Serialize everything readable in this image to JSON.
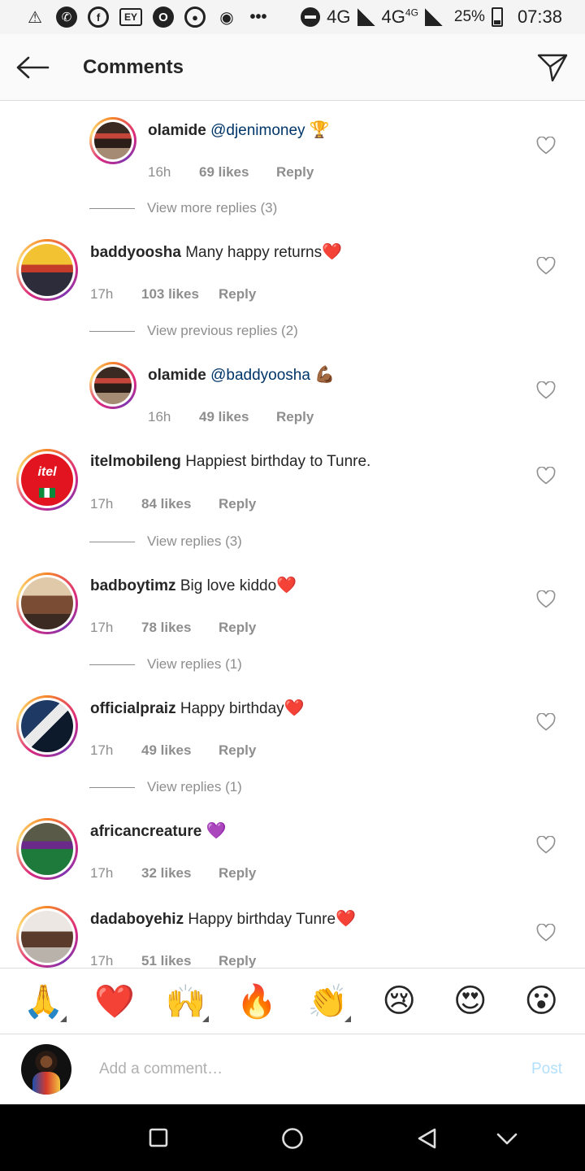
{
  "status_bar": {
    "icons": [
      "warning-icon",
      "whatsapp-icon",
      "facebook-icon",
      "ey-icon",
      "opera-icon",
      "chrome-icon",
      "notification-icon",
      "more-icon"
    ],
    "ey_label": "EY",
    "more": "•••",
    "network1": "4G",
    "network2": "4G",
    "network2_sup": "4G",
    "battery": "25%",
    "time": "07:38"
  },
  "header": {
    "title": "Comments"
  },
  "comments": [
    {
      "user": "olamide",
      "mention": "@djenimoney",
      "text": "",
      "emoji": "🏆",
      "time": "16h",
      "likes": "69 likes",
      "reply": "Reply",
      "avatar": "olamide-avatar"
    },
    {
      "view_text": "View more replies (3)"
    },
    {
      "user": "baddyoosha",
      "text": "Many happy returns",
      "emoji": "❤️",
      "time": "17h",
      "likes": "103 likes",
      "reply": "Reply",
      "avatar": "baddyoosha-avatar"
    },
    {
      "view_text": "View previous replies (2)"
    },
    {
      "user": "olamide",
      "mention": "@baddyoosha",
      "text": "",
      "emoji": "💪🏾",
      "time": "16h",
      "likes": "49 likes",
      "reply": "Reply",
      "avatar": "olamide-avatar"
    },
    {
      "user": "itelmobileng",
      "text": "Happiest birthday to Tunre.",
      "emoji": "",
      "time": "17h",
      "likes": "84 likes",
      "reply": "Reply",
      "avatar": "itel-avatar",
      "avatar_text": "itel"
    },
    {
      "view_text": "View replies (3)"
    },
    {
      "user": "badboytimz",
      "text": "Big love kiddo",
      "emoji": "❤️",
      "time": "17h",
      "likes": "78 likes",
      "reply": "Reply",
      "avatar": "badboytimz-avatar"
    },
    {
      "view_text": "View replies (1)"
    },
    {
      "user": "officialpraiz",
      "text": "Happy birthday",
      "emoji": "❤️",
      "time": "17h",
      "likes": "49 likes",
      "reply": "Reply",
      "avatar": "officialpraiz-avatar"
    },
    {
      "view_text": "View replies (1)"
    },
    {
      "user": "africancreature",
      "text": "",
      "emoji": "💜",
      "time": "17h",
      "likes": "32 likes",
      "reply": "Reply",
      "avatar": "africancreature-avatar"
    },
    {
      "user": "dadaboyehiz",
      "text": "Happy birthday Tunre",
      "emoji": "❤️",
      "time": "17h",
      "likes": "51 likes",
      "reply": "Reply",
      "avatar": "dadaboyehiz-avatar"
    }
  ],
  "emoji_bar": [
    "🙏",
    "❤️",
    "🙌",
    "🔥",
    "👏",
    "😢",
    "😍",
    "😮"
  ],
  "composer": {
    "placeholder": "Add a comment…",
    "post": "Post"
  },
  "nav": [
    "recents-button",
    "home-button",
    "back-button",
    "hide-keyboard-button"
  ],
  "colors": {
    "mention": "#003569",
    "meta": "#8e8e8e",
    "post_disabled": "#b2dffc"
  }
}
